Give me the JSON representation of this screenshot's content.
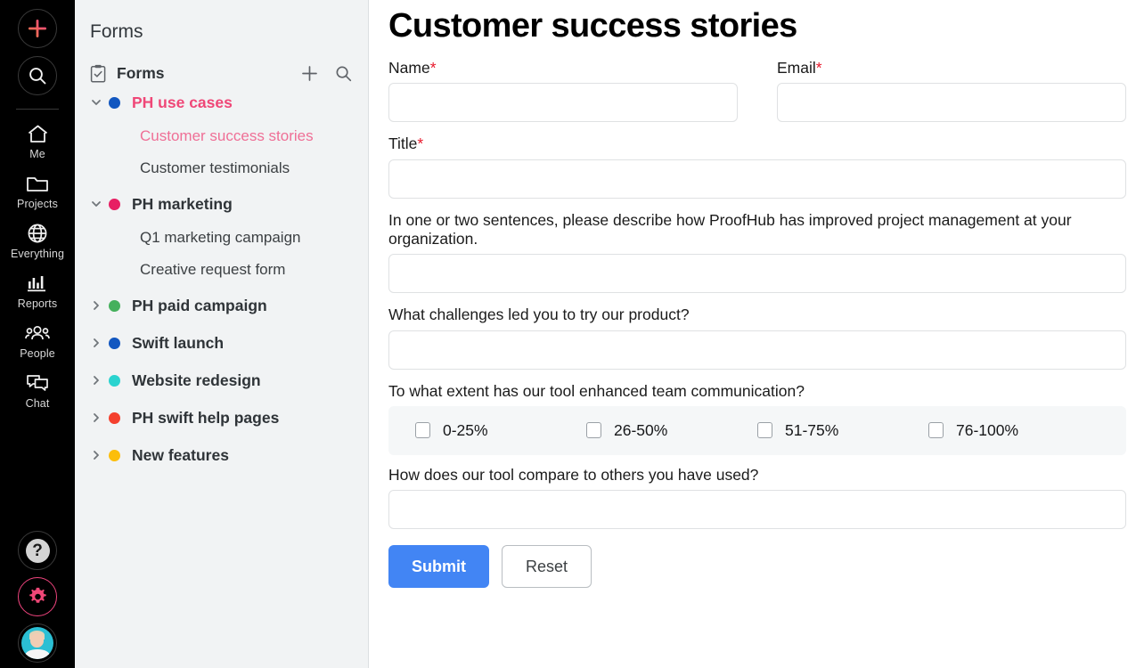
{
  "rail": {
    "add_button": "add-new",
    "search_button": "search",
    "items": [
      {
        "icon": "home-icon",
        "label": "Me"
      },
      {
        "icon": "folder-icon",
        "label": "Projects"
      },
      {
        "icon": "globe-icon",
        "label": "Everything"
      },
      {
        "icon": "bar-chart-icon",
        "label": "Reports"
      },
      {
        "icon": "people-icon",
        "label": "People"
      },
      {
        "icon": "chat-icon",
        "label": "Chat"
      }
    ],
    "help_label": "?",
    "settings_icon": "gear-icon",
    "avatar_label": "user-avatar",
    "accent_pink": "#f0447e",
    "accent_orange": "#f47b4a"
  },
  "sidebar": {
    "panel_title": "Forms",
    "section_title": "Forms",
    "section_icon": "clipboard-check-icon",
    "add_action": "+",
    "search_action": "search-icon",
    "active_color": "#ef4777",
    "projects": [
      {
        "name": "PH use cases",
        "dot_color": "#1257c0",
        "expanded": true,
        "active": true,
        "children": [
          {
            "label": "Customer success stories",
            "active": true
          },
          {
            "label": "Customer testimonials",
            "active": false
          }
        ]
      },
      {
        "name": "PH marketing",
        "dot_color": "#e71f63",
        "expanded": true,
        "active": false,
        "children": [
          {
            "label": "Q1 marketing campaign",
            "active": false
          },
          {
            "label": "Creative request form",
            "active": false
          }
        ]
      },
      {
        "name": "PH paid campaign",
        "dot_color": "#45b05c",
        "expanded": false,
        "active": false,
        "children": []
      },
      {
        "name": "Swift launch",
        "dot_color": "#1257c0",
        "expanded": false,
        "active": false,
        "children": []
      },
      {
        "name": "Website redesign",
        "dot_color": "#2ad3cf",
        "expanded": false,
        "active": false,
        "children": []
      },
      {
        "name": "PH swift help pages",
        "dot_color": "#f4402e",
        "expanded": false,
        "active": false,
        "children": []
      },
      {
        "name": "New features",
        "dot_color": "#fcbe0b",
        "expanded": false,
        "active": false,
        "children": []
      }
    ]
  },
  "form": {
    "title": "Customer success stories",
    "required_mark": "*",
    "fields": [
      {
        "label": "Name",
        "required": true,
        "value": "",
        "placeholder": ""
      },
      {
        "label": "Email",
        "required": true,
        "value": "",
        "placeholder": ""
      },
      {
        "label": "Title",
        "required": true,
        "value": "",
        "placeholder": ""
      },
      {
        "label": "In one or two sentences, please describe how ProofHub has improved project management at your organization.",
        "required": false,
        "value": "",
        "placeholder": ""
      },
      {
        "label": "What challenges led you to try our product?",
        "required": false,
        "value": "",
        "placeholder": ""
      },
      {
        "label": "To what extent has our tool enhanced team communication?",
        "required": false,
        "value": "",
        "placeholder": ""
      },
      {
        "label": "How does our tool compare to others you have used?",
        "required": false,
        "value": "",
        "placeholder": ""
      }
    ],
    "checkbox_options": [
      {
        "label": "0-25%",
        "checked": false
      },
      {
        "label": "26-50%",
        "checked": false
      },
      {
        "label": "51-75%",
        "checked": false
      },
      {
        "label": "76-100%",
        "checked": false
      }
    ],
    "submit_label": "Submit",
    "reset_label": "Reset",
    "submit_color": "#4285f4"
  }
}
